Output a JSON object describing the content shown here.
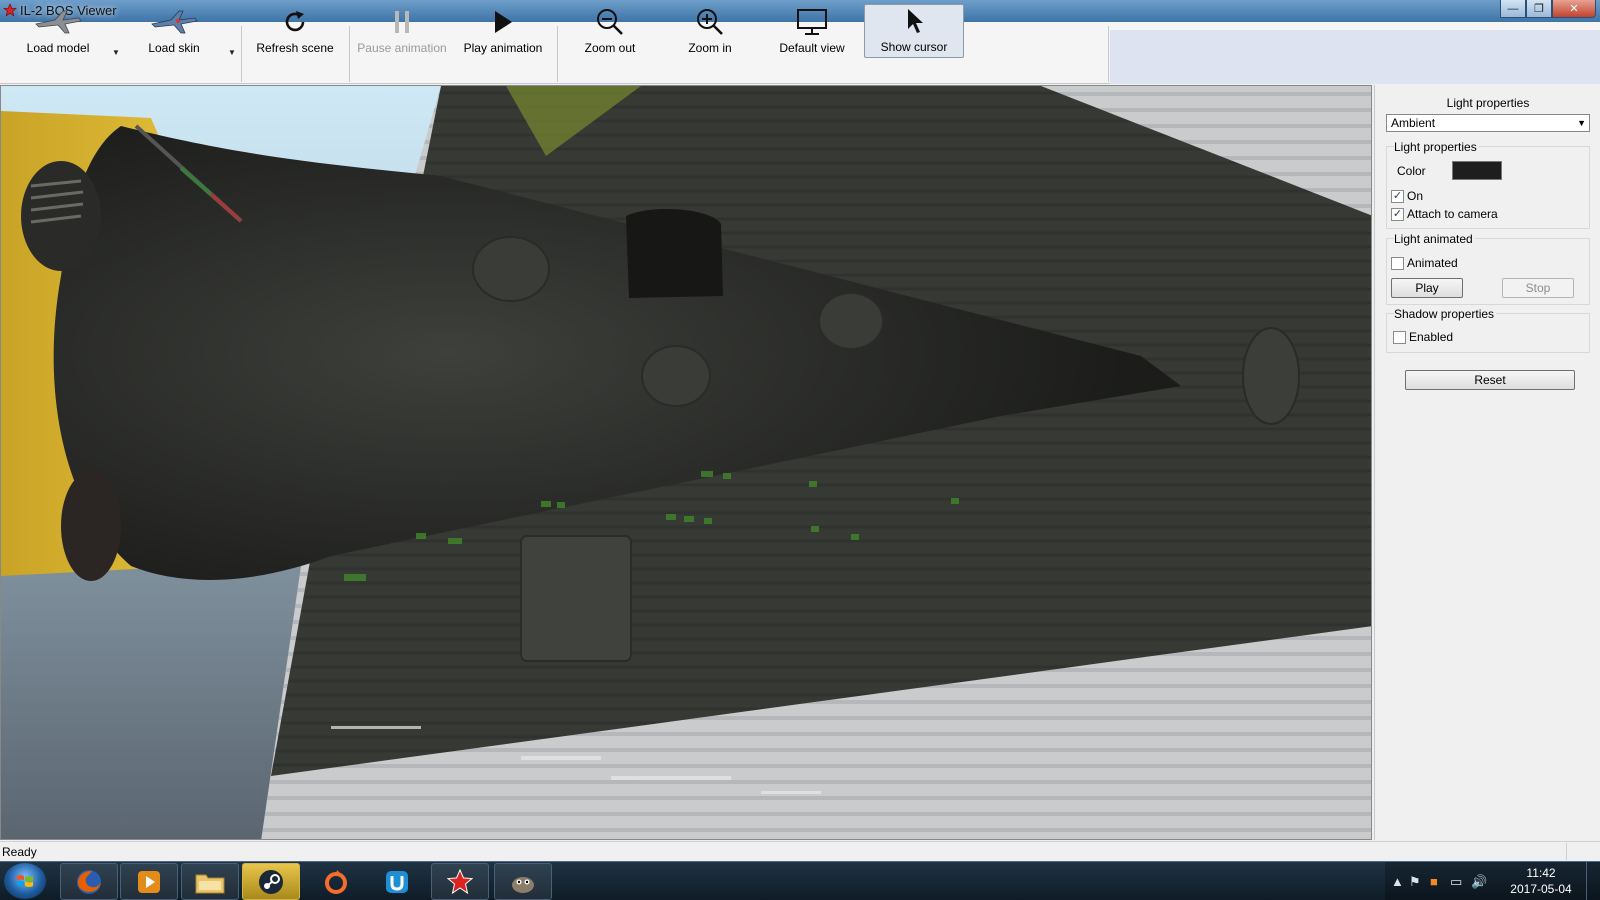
{
  "window": {
    "title": "IL-2 BOS Viewer",
    "min_glyph": "—",
    "max_glyph": "❐",
    "close_glyph": "✕"
  },
  "toolbar": {
    "load_model": "Load model",
    "load_skin": "Load skin",
    "refresh_scene": "Refresh scene",
    "pause_animation": "Pause animation",
    "play_animation": "Play animation",
    "zoom_out": "Zoom out",
    "zoom_in": "Zoom in",
    "default_view": "Default view",
    "show_cursor": "Show cursor",
    "dropdown_glyph": "▼"
  },
  "panel": {
    "title": "Light properties",
    "light_type": "Ambient",
    "combo_arrow": "▼",
    "light_group": {
      "title": "Light properties",
      "color_label": "Color",
      "color_value": "#1e1e1e",
      "on_label": "On",
      "on_checked": true,
      "attach_label": "Attach to camera",
      "attach_checked": true
    },
    "animated_group": {
      "title": "Light animated",
      "animated_label": "Animated",
      "animated_checked": false,
      "play_label": "Play",
      "stop_label": "Stop"
    },
    "shadow_group": {
      "title": "Shadow properties",
      "enabled_label": "Enabled",
      "enabled_checked": false
    },
    "reset_label": "Reset"
  },
  "status": {
    "text": "Ready"
  },
  "taskbar": {
    "apps": [
      "firefox-icon",
      "media-player-icon",
      "file-explorer-icon",
      "steam-icon",
      "origin-icon",
      "uplay-icon",
      "il2-viewer-icon",
      "gimp-icon"
    ],
    "tray_glyphs": [
      "▲",
      "⚑",
      "■",
      "▭",
      "🔊"
    ],
    "clock_time": "11:42",
    "clock_date": "2017-05-04"
  },
  "colors": {
    "accent": "#3f74a8",
    "viewport_sky": "#cfe6f4",
    "fuselage": "#2f302e",
    "yellow_cowl": "#d9b52c"
  }
}
